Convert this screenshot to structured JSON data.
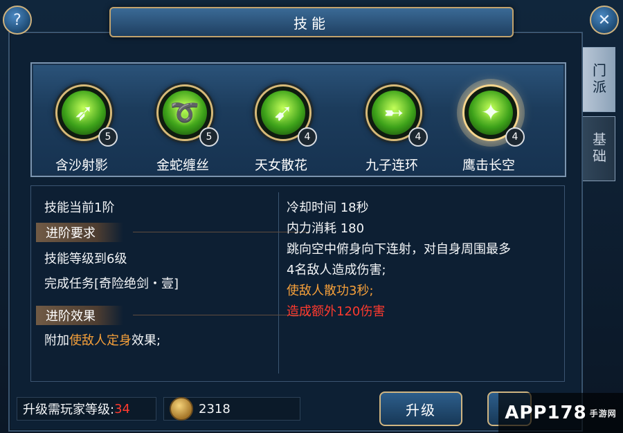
{
  "window": {
    "title": "技能"
  },
  "buttons": {
    "help": "?",
    "close": "✕",
    "upgrade": "升级"
  },
  "tabs": [
    {
      "label": "门派"
    },
    {
      "label": "基础"
    }
  ],
  "skills": [
    {
      "name": "含沙射影",
      "level": "5",
      "icon": "arrow-burst-icon"
    },
    {
      "name": "金蛇缠丝",
      "level": "5",
      "icon": "serpent-swirl-icon"
    },
    {
      "name": "天女散花",
      "level": "4",
      "icon": "scatter-arrows-icon"
    },
    {
      "name": "九子连环",
      "level": "4",
      "icon": "chain-arrows-icon"
    },
    {
      "name": "鹰击长空",
      "level": "4",
      "icon": "eagle-strike-icon"
    }
  ],
  "selected_skill_index": 4,
  "detail": {
    "stage": "技能当前1阶",
    "advance_requirement_title": "进阶要求",
    "req_1": "技能等级到6级",
    "req_2": "完成任务[奇险绝剑・壹]",
    "advance_effect_title": "进阶效果",
    "effect_prefix": "附加",
    "effect_highlight": "使敌人定身",
    "effect_suffix": "效果;",
    "cooldown": "冷却时间 18秒",
    "cost": "内力消耗 180",
    "desc_1": "跳向空中俯身向下连射，对自身周围最多",
    "desc_2": "4名敌人造成伤害;",
    "desc_orange": "使敌人散功3秒;",
    "desc_red": "造成额外120伤害"
  },
  "bottom": {
    "req_label": "升级需玩家等级:",
    "req_value": "34",
    "money": "2318"
  },
  "watermark": {
    "brand": "APP178",
    "sub": "手游网"
  },
  "colors": {
    "orange": "#f6a03a",
    "red": "#ff3a2e",
    "gold_border": "#d0b581"
  }
}
